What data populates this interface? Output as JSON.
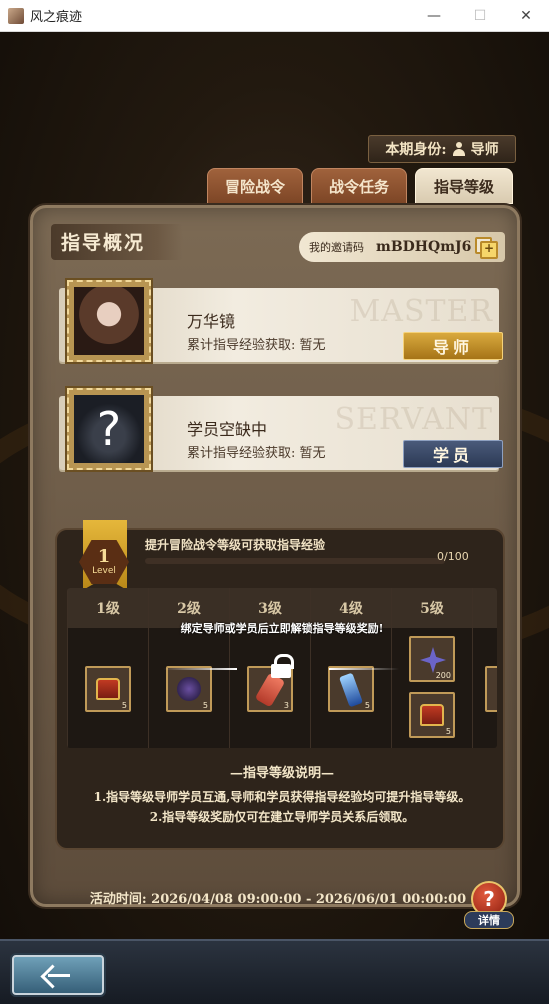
{
  "window": {
    "title": "风之痕迹",
    "minimize": "—",
    "maximize": "☐",
    "close": "✕"
  },
  "identity": {
    "label": "本期身份:",
    "role": "导师"
  },
  "tabs": [
    {
      "label": "冒险战令",
      "active": false
    },
    {
      "label": "战令任务",
      "active": false
    },
    {
      "label": "指导等级",
      "active": true
    }
  ],
  "overview": {
    "title": "指导概况",
    "invite_label": "我的邀请码",
    "invite_code": "mBDHQmJ6"
  },
  "roles": [
    {
      "name": "万华镜",
      "exp_label": "累计指导经验获取:",
      "exp_value": "暂无",
      "badge": "导师",
      "watermark": "MASTER"
    },
    {
      "name": "学员空缺中",
      "exp_label": "累计指导经验获取:",
      "exp_value": "暂无",
      "badge": "学员",
      "watermark": "SERVANT",
      "placeholder_glyph": "?"
    }
  ],
  "level": {
    "number": "1",
    "word": "Level",
    "hint": "提升冒险战令等级可获取指导经验",
    "progress": "0/100",
    "progress_fraction": 0,
    "lock_text": "绑定导师或学员后立即解锁指导等级奖励!",
    "columns": [
      {
        "label": "1级",
        "items": [
          {
            "icon": "treasure-chest-icon",
            "count": "5"
          }
        ]
      },
      {
        "label": "2级",
        "items": [
          {
            "icon": "dark-orb-icon",
            "count": "5"
          }
        ]
      },
      {
        "label": "3级",
        "items": [
          {
            "icon": "scroll-icon",
            "count": "3"
          }
        ]
      },
      {
        "label": "4级",
        "items": [
          {
            "icon": "potion-icon",
            "count": "5"
          }
        ]
      },
      {
        "label": "5级",
        "items": [
          {
            "icon": "star-crystal-icon",
            "count": "200"
          },
          {
            "icon": "treasure-chest-icon",
            "count": "5"
          }
        ]
      }
    ]
  },
  "explain": {
    "title": "—指导等级说明—",
    "line1": "1.指导等级导师学员互通,导师和学员获得指导经验均可提升指导等级。",
    "line2": "2.指导等级奖励仅可在建立导师学员关系后领取。"
  },
  "activity": {
    "text": "活动时间: 2026/04/08 09:00:00 - 2026/06/01 00:00:00"
  },
  "help": {
    "glyph": "?",
    "label": "详情"
  },
  "colors": {
    "accent_gold": "#d9a93e",
    "student_blue": "#2c3a55",
    "panel_brown": "#6c5843"
  }
}
